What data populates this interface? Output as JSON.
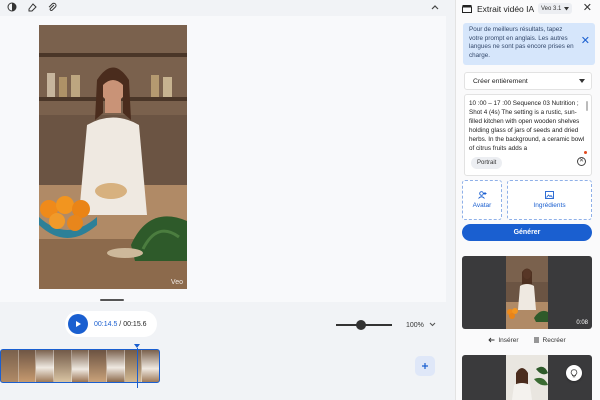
{
  "editor": {
    "toolbar": {
      "icons": [
        "contrast-icon",
        "eraser-icon",
        "paperclip-icon"
      ],
      "collapse_icon": "chevron-up-icon"
    },
    "preview": {
      "watermark": "Veo"
    },
    "playback": {
      "current_time": "00:14.5",
      "separator": " / ",
      "total_time": "00:15.6"
    },
    "zoom": {
      "level": "100%",
      "slider_fraction": 0.45
    },
    "timeline": {
      "clip_count": 9,
      "add_icon": "plus-icon"
    }
  },
  "panel": {
    "title": "Extrait vidéo IA",
    "model": "Veo 3.1",
    "banner": "Pour de meilleurs résultats, tapez votre prompt en anglais. Les autres langues ne sont pas encore prises en charge.",
    "mode": "Créer entièrement",
    "prompt": "10 :00 – 17 :00  Sequence 03 Nutrition ; Shot 4 (4s) The setting is a rustic, sun-filled kitchen with open wooden shelves holding glass of jars of seeds and dried herbs. In the background, a ceramic bowl of citrus fruits adds a",
    "aspect_chip": "Portrait",
    "options": {
      "avatar": "Avatar",
      "ingredients": "Ingrédients"
    },
    "generate": "Générer",
    "results": {
      "first_duration": "0:08",
      "insert": "Insérer",
      "recreate": "Recréer"
    }
  },
  "colors": {
    "accent": "#1a5fd0",
    "banner_bg": "#d6e6fb",
    "panel_bg": "#fafafb"
  }
}
